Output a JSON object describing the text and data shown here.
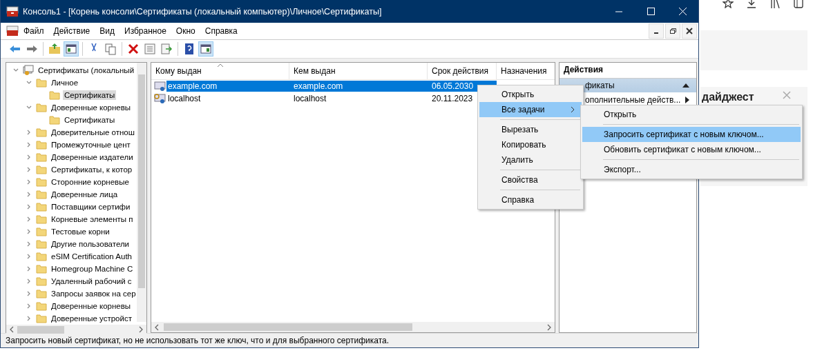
{
  "window": {
    "title": "Консоль1 - [Корень консоли\\Сертификаты (локальный компьютер)\\Личное\\Сертификаты]"
  },
  "menu": [
    "Файл",
    "Действие",
    "Вид",
    "Избранное",
    "Окно",
    "Справка"
  ],
  "toolbar": [
    {
      "kind": "back",
      "pressed": false
    },
    {
      "kind": "forward",
      "pressed": false
    },
    {
      "kind": "sep"
    },
    {
      "kind": "up",
      "pressed": false
    },
    {
      "kind": "tree",
      "pressed": true
    },
    {
      "kind": "sep"
    },
    {
      "kind": "cut",
      "pressed": false
    },
    {
      "kind": "copy",
      "pressed": false
    },
    {
      "kind": "sep"
    },
    {
      "kind": "delete",
      "pressed": false
    },
    {
      "kind": "properties",
      "pressed": false
    },
    {
      "kind": "export",
      "pressed": false
    },
    {
      "kind": "sep"
    },
    {
      "kind": "help",
      "pressed": false
    },
    {
      "kind": "pane",
      "pressed": true
    }
  ],
  "tree": [
    {
      "label": "Сертификаты (локальный",
      "kind": "store",
      "expanded": true,
      "selected": false,
      "children": [
        {
          "label": "Личное",
          "kind": "folder",
          "expanded": true,
          "selected": false,
          "children": [
            {
              "label": "Сертификаты",
              "kind": "folder",
              "selected": true
            }
          ]
        },
        {
          "label": "Доверенные корневы",
          "kind": "folder",
          "expanded": true,
          "selected": false,
          "children": [
            {
              "label": "Сертификаты",
              "kind": "folder",
              "selected": false
            }
          ]
        },
        {
          "label": "Доверительные отнош",
          "kind": "folder",
          "expanded": false,
          "selected": false
        },
        {
          "label": "Промежуточные цент",
          "kind": "folder",
          "expanded": false,
          "selected": false
        },
        {
          "label": "Доверенные издатели",
          "kind": "folder",
          "expanded": false,
          "selected": false
        },
        {
          "label": "Сертификаты, к котор",
          "kind": "folder",
          "expanded": false,
          "selected": false
        },
        {
          "label": "Сторонние корневые",
          "kind": "folder",
          "expanded": false,
          "selected": false
        },
        {
          "label": "Доверенные лица",
          "kind": "folder",
          "expanded": false,
          "selected": false
        },
        {
          "label": "Поставщики сертифи",
          "kind": "folder",
          "expanded": false,
          "selected": false
        },
        {
          "label": "Корневые элементы п",
          "kind": "folder",
          "expanded": false,
          "selected": false
        },
        {
          "label": "Тестовые корни",
          "kind": "folder",
          "expanded": false,
          "selected": false
        },
        {
          "label": "Другие пользователи",
          "kind": "folder",
          "expanded": false,
          "selected": false
        },
        {
          "label": "eSIM Certification Auth",
          "kind": "folder",
          "expanded": false,
          "selected": false
        },
        {
          "label": "Homegroup Machine C",
          "kind": "folder",
          "expanded": false,
          "selected": false
        },
        {
          "label": "Удаленный рабочий с",
          "kind": "folder",
          "expanded": false,
          "selected": false
        },
        {
          "label": "Запросы заявок на сер",
          "kind": "folder",
          "expanded": false,
          "selected": false
        },
        {
          "label": "Доверенные корневы",
          "kind": "folder",
          "expanded": false,
          "selected": false
        },
        {
          "label": "Доверенные устройст",
          "kind": "folder",
          "expanded": false,
          "selected": false
        }
      ]
    }
  ],
  "table": {
    "columns": [
      {
        "label": "Кому выдан",
        "sorted": true
      },
      {
        "label": "Кем выдан",
        "sorted": false
      },
      {
        "label": "Срок действия",
        "sorted": false
      },
      {
        "label": "Назначения",
        "sorted": false
      }
    ],
    "rows": [
      {
        "cells": [
          "example.com",
          "example.com",
          "06.05.2030"
        ],
        "selected": true,
        "kind": "cert"
      },
      {
        "cells": [
          "localhost",
          "localhost",
          "20.11.2023"
        ],
        "selected": false,
        "kind": "cert-key"
      }
    ]
  },
  "actions": {
    "title": "Действия",
    "section": "фикаты",
    "items": [
      "ополнительные действ..."
    ]
  },
  "context_menu": {
    "groups": [
      [
        {
          "label": "Открыть",
          "selected": false,
          "submenu": false
        },
        {
          "label": "Все задачи",
          "selected": true,
          "submenu": true
        }
      ],
      [
        {
          "label": "Вырезать",
          "selected": false,
          "submenu": false
        },
        {
          "label": "Копировать",
          "selected": false,
          "submenu": false
        },
        {
          "label": "Удалить",
          "selected": false,
          "submenu": false
        }
      ],
      [
        {
          "label": "Свойства",
          "selected": false,
          "submenu": false
        }
      ],
      [
        {
          "label": "Справка",
          "selected": false,
          "submenu": false
        }
      ]
    ]
  },
  "submenu": {
    "groups": [
      [
        {
          "label": "Открыть",
          "selected": false
        }
      ],
      [
        {
          "label": "Запросить сертификат с новым ключом...",
          "selected": true
        },
        {
          "label": "Обновить сертификат с новым ключом...",
          "selected": false
        }
      ],
      [
        {
          "label": "Экспорт...",
          "selected": false
        }
      ]
    ]
  },
  "status_bar": "Запросить новый сертификат, но не использовать тот же ключ, что и для выбранного сертификата.",
  "browser": {
    "card_title": "дайджест"
  }
}
